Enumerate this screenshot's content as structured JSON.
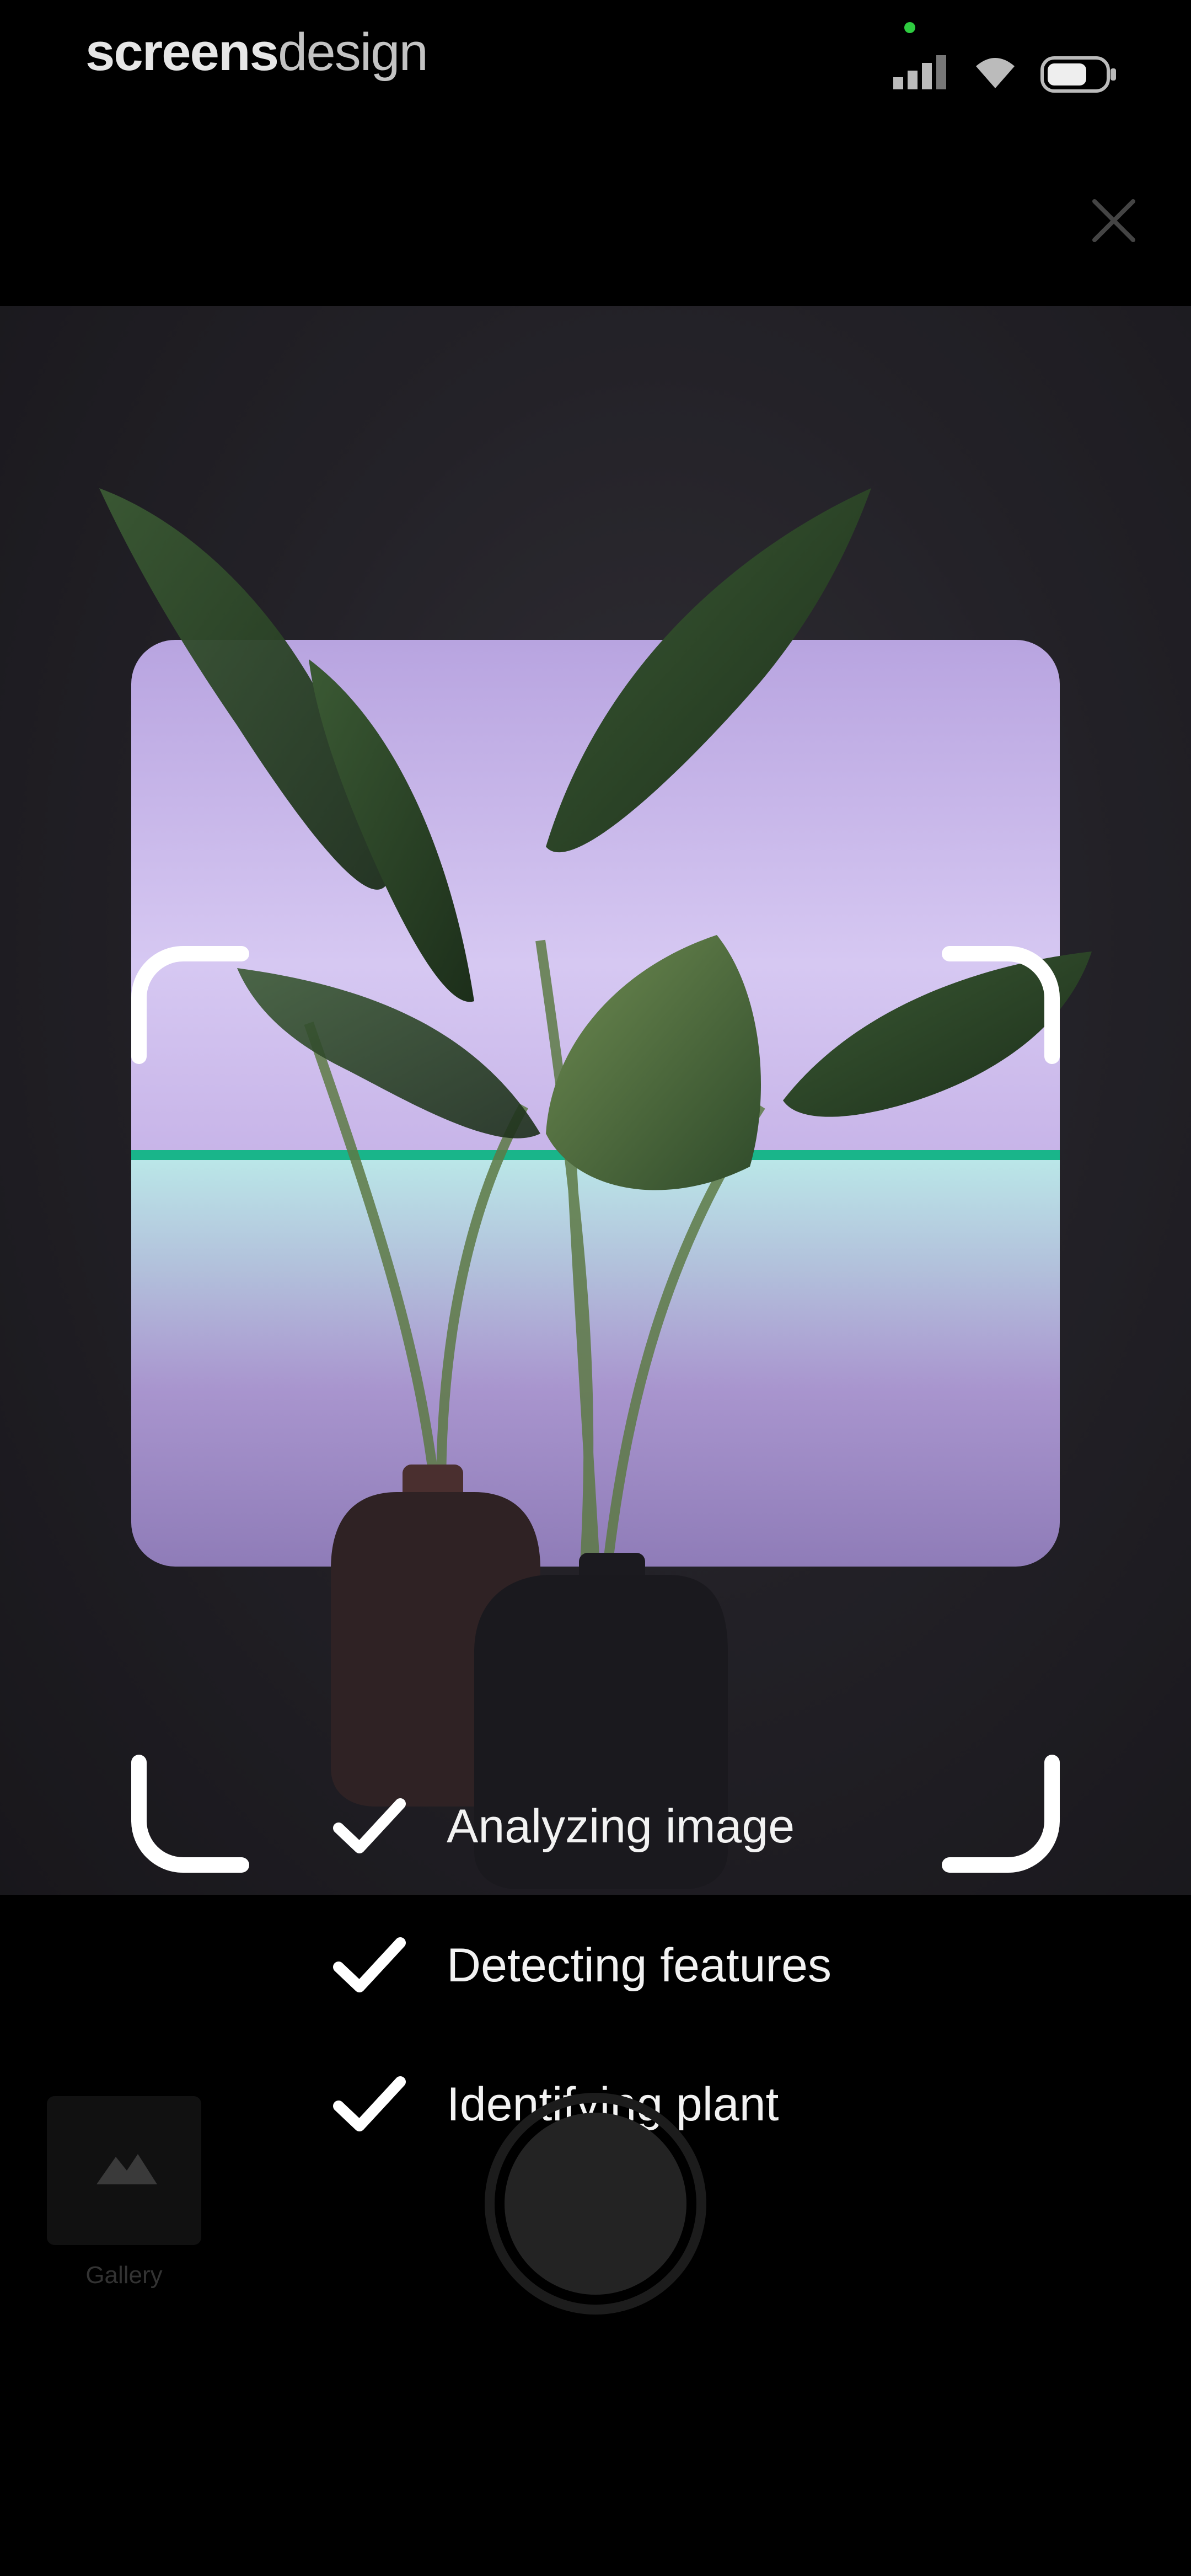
{
  "brand": {
    "bold": "screens",
    "light": "design"
  },
  "status": {
    "signal_icon": "signal-icon",
    "wifi_icon": "wifi-icon",
    "battery_icon": "battery-icon",
    "indicator_color": "#2ecc40"
  },
  "header": {
    "close_icon": "close-icon"
  },
  "scanner": {
    "frame_color": "#ffffff",
    "scan_line_color": "#19b58a"
  },
  "progress": {
    "items": [
      {
        "label": "Analyzing image",
        "icon": "check-icon"
      },
      {
        "label": "Detecting features",
        "icon": "check-icon"
      },
      {
        "label": "Identifying plant",
        "icon": "check-icon"
      }
    ]
  },
  "bottom": {
    "gallery_label": "Gallery",
    "gallery_icon": "mountain-icon",
    "shutter_icon": "shutter-button"
  }
}
